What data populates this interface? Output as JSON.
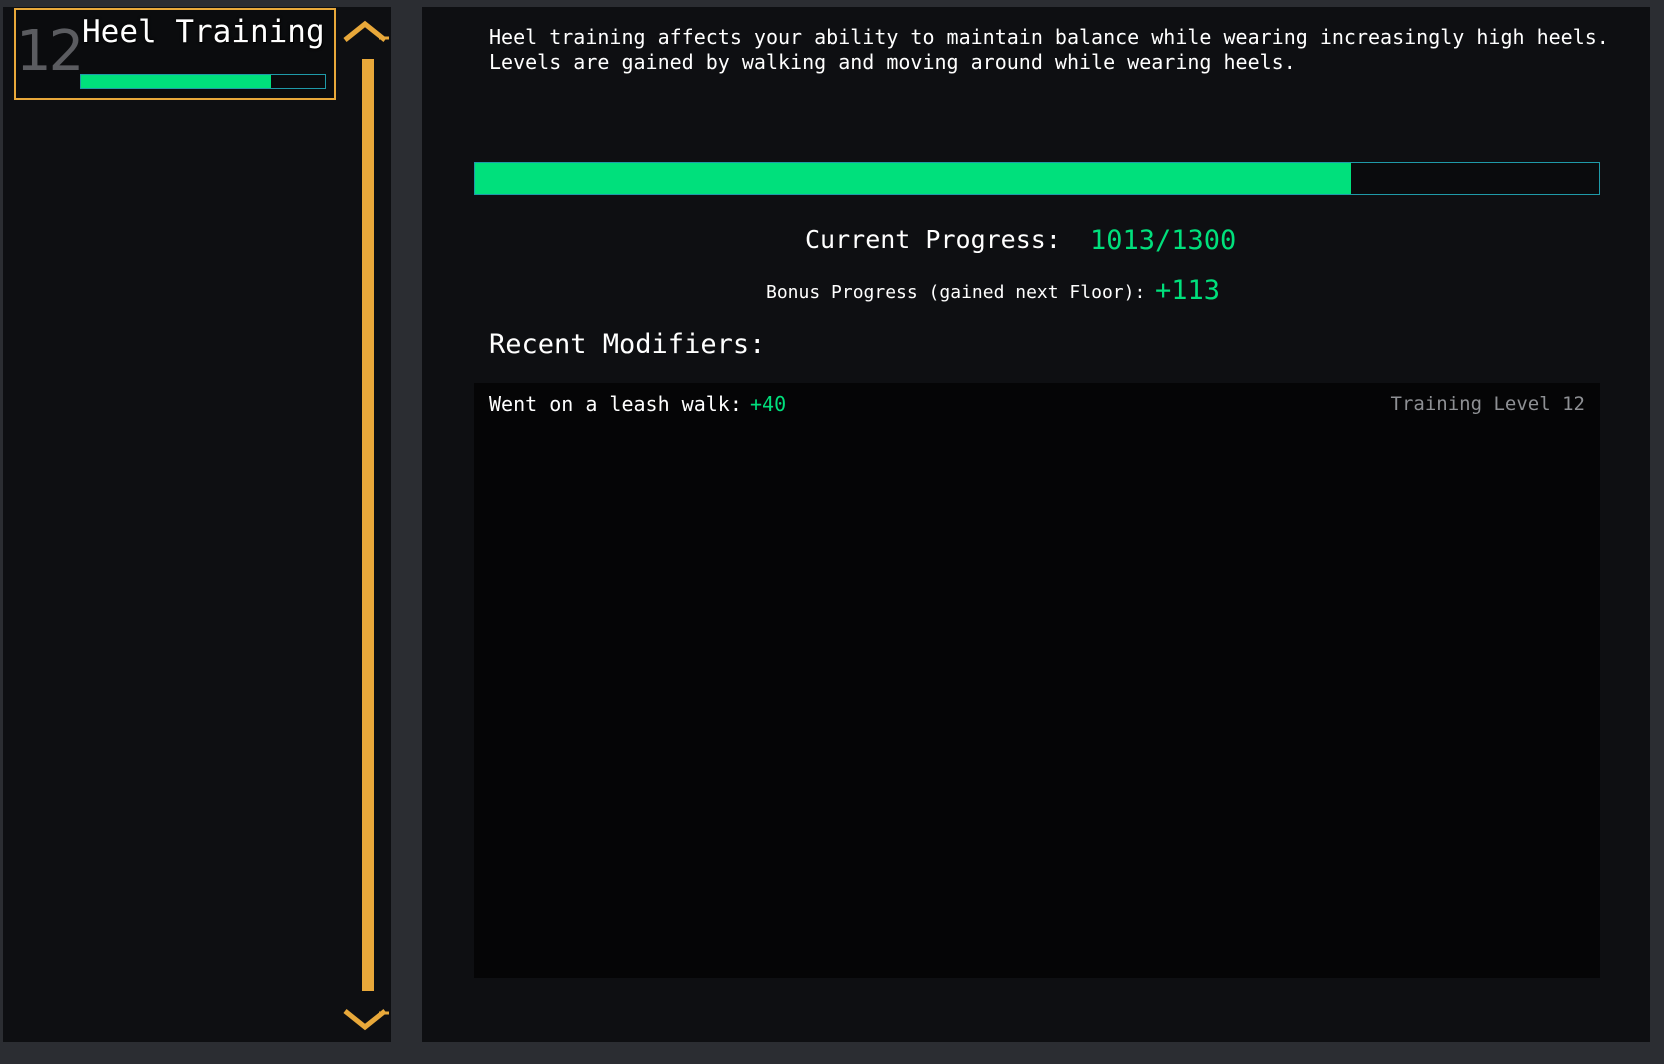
{
  "skill_list": {
    "items": [
      {
        "level": "12",
        "name": "Heel Training",
        "progress_fraction": 0.7792
      }
    ]
  },
  "detail": {
    "description": "Heel training affects your ability to maintain balance while wearing increasingly high heels.\nLevels are gained by walking and moving around while wearing heels.",
    "progress_fraction": 0.7792,
    "current_progress_label": "Current Progress:",
    "current_progress_value": "1013/1300",
    "bonus_label": "Bonus Progress (gained next Floor):",
    "bonus_value": "+113",
    "modifiers_title": "Recent Modifiers:",
    "modifiers": [
      {
        "label": "Went on a leash walk:",
        "value": "+40",
        "source": "Training Level 12"
      }
    ]
  },
  "colors": {
    "accent_gold": "#e8a83a",
    "progress_green": "#00e07c",
    "bar_border": "#1f9aa8",
    "panel_bg": "#0e0f12"
  },
  "icons": {
    "scroll_up": "chevron-up-icon",
    "scroll_down": "chevron-down-icon"
  }
}
